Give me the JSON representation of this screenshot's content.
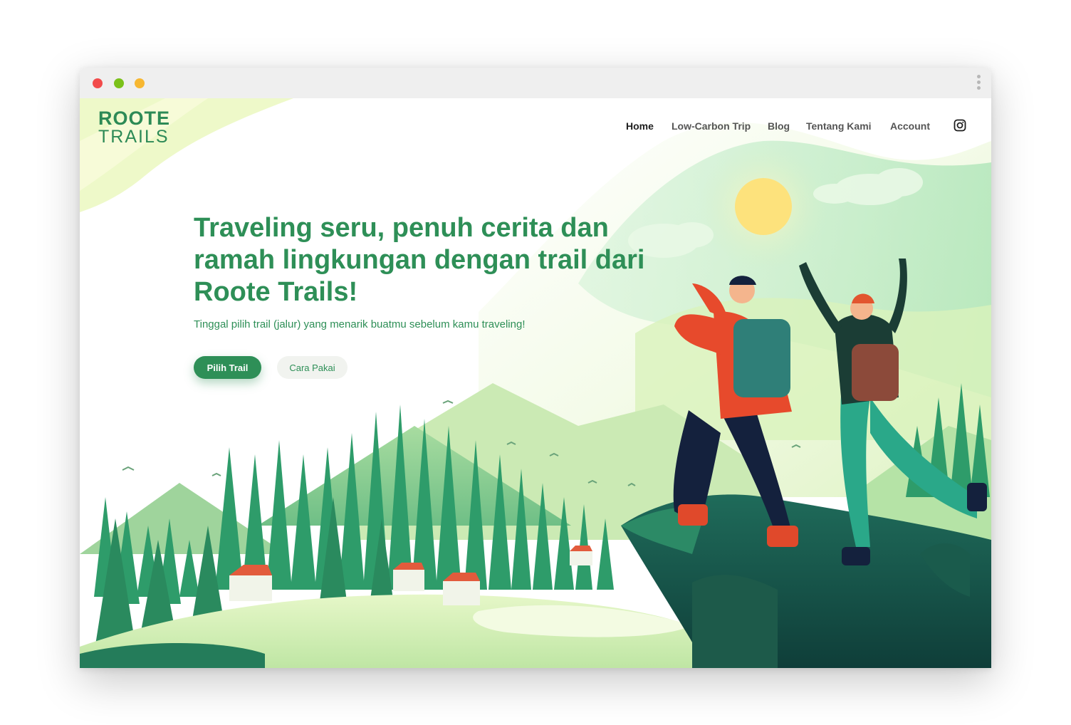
{
  "browser": {
    "menu_icon": "kebab-menu-icon"
  },
  "brand": {
    "logo_line1": "ROOTE",
    "logo_line2": "TRAILS",
    "color": "#2e8f57"
  },
  "nav": {
    "items": [
      {
        "label": "Home",
        "active": true
      },
      {
        "label": "Low-Carbon Trip"
      },
      {
        "label": "Blog"
      },
      {
        "label": "Tentang Kami"
      },
      {
        "label": "Account"
      }
    ],
    "social_icon": "instagram-icon"
  },
  "hero": {
    "headline": "Traveling seru, penuh cerita dan ramah lingkungan dengan trail dari Roote Trails!",
    "subline": "Tinggal pilih trail (jalur) yang menarik buatmu sebelum kamu traveling!",
    "primary_button": "Pilih Trail",
    "secondary_button": "Cara Pakai"
  },
  "colors": {
    "accent": "#2e8f57",
    "accent_light": "#e9f7d8",
    "sun": "#fce27a"
  }
}
